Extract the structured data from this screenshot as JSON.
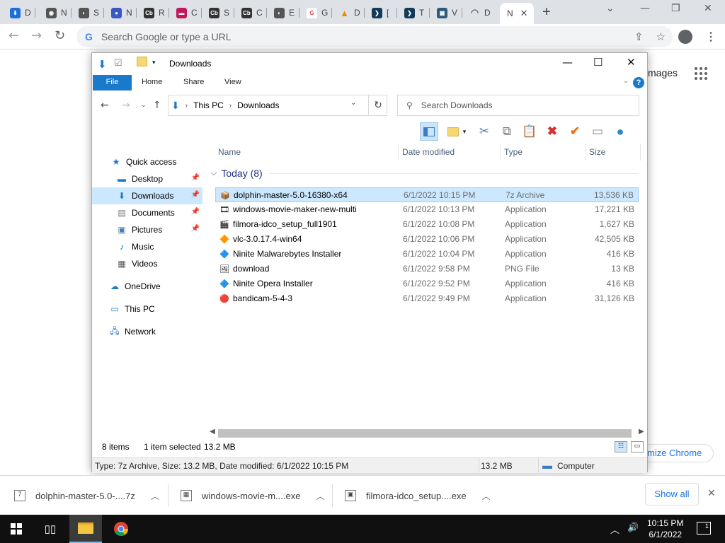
{
  "browser": {
    "tabs": [
      {
        "initial": "D",
        "fav_color": "#1e6fd9",
        "fav_glyph": "⬇"
      },
      {
        "initial": "N",
        "fav_color": "#555555",
        "fav_glyph": "◉"
      },
      {
        "initial": "S",
        "fav_color": "#555555",
        "fav_glyph": "◐"
      },
      {
        "initial": "N",
        "fav_color": "#3a57c4",
        "fav_glyph": "●"
      },
      {
        "initial": "R",
        "fav_color": "#333333",
        "fav_glyph": "Cb"
      },
      {
        "initial": "C",
        "fav_color": "#c2185b",
        "fav_glyph": "▬"
      },
      {
        "initial": "S",
        "fav_color": "#333333",
        "fav_glyph": "Cb"
      },
      {
        "initial": "C",
        "fav_color": "#333333",
        "fav_glyph": "Cb"
      },
      {
        "initial": "E",
        "fav_color": "#555555",
        "fav_glyph": "◐"
      },
      {
        "initial": "G",
        "fav_color": "#ea4335",
        "fav_glyph": "G"
      },
      {
        "initial": "D",
        "fav_color": "#f28b00",
        "fav_glyph": "▲"
      },
      {
        "initial": "[",
        "fav_color": "#123a5a",
        "fav_glyph": "❯"
      },
      {
        "initial": "T",
        "fav_color": "#123a5a",
        "fav_glyph": "❯"
      },
      {
        "initial": "V",
        "fav_color": "#2e5a7a",
        "fav_glyph": "▦"
      },
      {
        "initial": "D",
        "fav_color": "#666666",
        "fav_glyph": "◠"
      },
      {
        "initial": "N",
        "fav_color": "#ffffff",
        "fav_glyph": ""
      }
    ],
    "new_tab": "+",
    "omnibox_placeholder": "Search Google or type a URL",
    "omnibox_g": "G"
  },
  "page": {
    "images_link": "mages",
    "customize": "mize Chrome"
  },
  "explorer": {
    "title": "Downloads",
    "ribbon_tabs": [
      "File",
      "Home",
      "Share",
      "View"
    ],
    "address": {
      "root": "This PC",
      "folder": "Downloads"
    },
    "search_placeholder": "Search Downloads",
    "nav": {
      "quick_access": "Quick access",
      "desktop": "Desktop",
      "downloads": "Downloads",
      "documents": "Documents",
      "pictures": "Pictures",
      "music": "Music",
      "videos": "Videos",
      "onedrive": "OneDrive",
      "this_pc": "This PC",
      "network": "Network"
    },
    "columns": {
      "name": "Name",
      "date": "Date modified",
      "type": "Type",
      "size": "Size"
    },
    "group": "Today (8)",
    "files": [
      {
        "name": "dolphin-master-5.0-16380-x64",
        "date": "6/1/2022 10:15 PM",
        "type": "7z Archive",
        "size": "13,536 KB",
        "icon": "📦",
        "selected": true
      },
      {
        "name": "windows-movie-maker-new-multi",
        "date": "6/1/2022 10:13 PM",
        "type": "Application",
        "size": "17,221 KB",
        "icon": "🎞",
        "selected": false
      },
      {
        "name": "filmora-idco_setup_full1901",
        "date": "6/1/2022 10:08 PM",
        "type": "Application",
        "size": "1,627 KB",
        "icon": "🎬",
        "selected": false
      },
      {
        "name": "vlc-3.0.17.4-win64",
        "date": "6/1/2022 10:06 PM",
        "type": "Application",
        "size": "42,505 KB",
        "icon": "🔶",
        "selected": false
      },
      {
        "name": "Ninite Malwarebytes Installer",
        "date": "6/1/2022 10:04 PM",
        "type": "Application",
        "size": "416 KB",
        "icon": "🔷",
        "selected": false
      },
      {
        "name": "download",
        "date": "6/1/2022 9:58 PM",
        "type": "PNG File",
        "size": "13 KB",
        "icon": "🖼",
        "selected": false
      },
      {
        "name": "Ninite Opera Installer",
        "date": "6/1/2022 9:52 PM",
        "type": "Application",
        "size": "416 KB",
        "icon": "🔷",
        "selected": false
      },
      {
        "name": "bandicam-5-4-3",
        "date": "6/1/2022 9:49 PM",
        "type": "Application",
        "size": "31,126 KB",
        "icon": "🔴",
        "selected": false
      }
    ],
    "status": {
      "items": "8 items",
      "selected": "1 item selected",
      "size": "13.2 MB"
    },
    "details": {
      "text": "Type: 7z Archive, Size: 13.2 MB, Date modified: 6/1/2022 10:15 PM",
      "size": "13.2 MB",
      "location": "Computer"
    }
  },
  "downloads_shelf": {
    "items": [
      {
        "name": "dolphin-master-5.0-....7z"
      },
      {
        "name": "windows-movie-m....exe"
      },
      {
        "name": "filmora-idco_setup....exe"
      }
    ],
    "show_all": "Show all"
  },
  "taskbar": {
    "time": "10:15 PM",
    "date": "6/1/2022",
    "notifications": "1"
  },
  "colors": {
    "accent": "#1979ca",
    "selection": "#cce8ff",
    "chrome_blue": "#1a73e8"
  }
}
